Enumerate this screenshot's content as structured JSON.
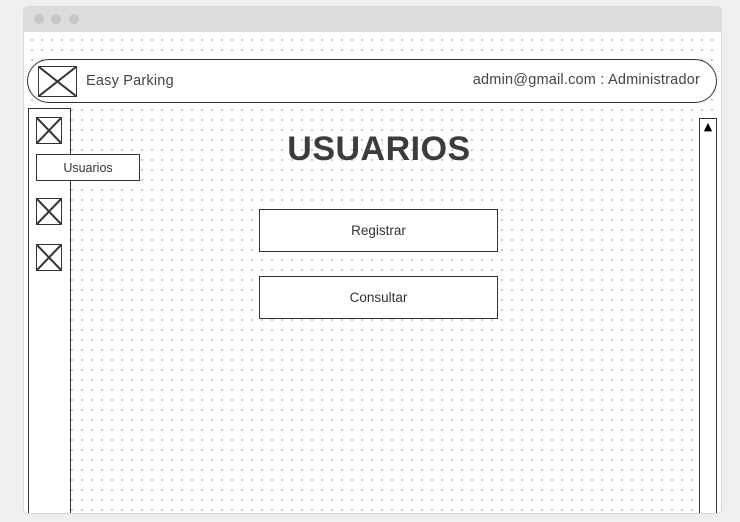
{
  "header": {
    "app_title": "Easy Parking",
    "user_info": "admin@gmail.com : Administrador",
    "logo_icon": "image-placeholder-icon"
  },
  "sidebar": {
    "items": [
      {
        "icon": "image-placeholder-icon",
        "tooltip": "Usuarios"
      },
      {
        "icon": "image-placeholder-icon"
      },
      {
        "icon": "image-placeholder-icon"
      }
    ]
  },
  "main": {
    "title": "USUARIOS",
    "buttons": [
      {
        "label": "Registrar"
      },
      {
        "label": "Consultar"
      }
    ]
  },
  "scrollbar": {
    "up_glyph": "▲",
    "down_glyph": "▼"
  }
}
